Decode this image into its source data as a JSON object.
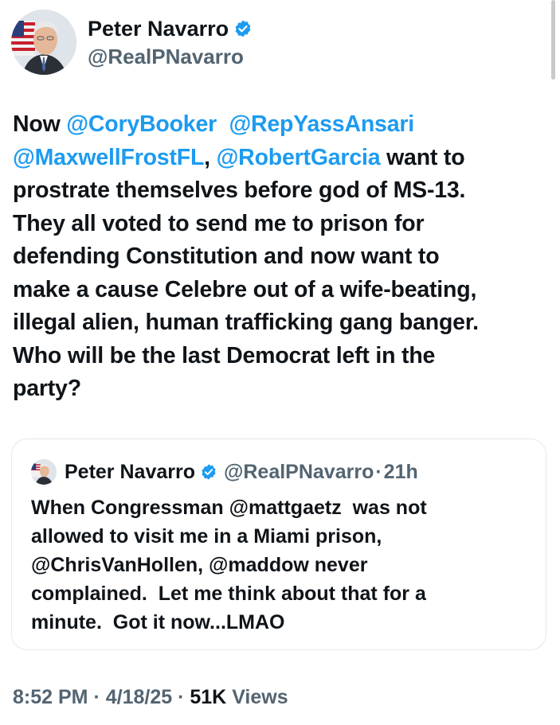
{
  "author": {
    "name": "Peter Navarro",
    "handle": "@RealPNavarro",
    "verified_icon": "verified-badge-icon",
    "avatar_icon": "profile-photo-icon"
  },
  "tweet": {
    "segments": [
      {
        "text": "Now ",
        "type": "text"
      },
      {
        "text": "@CoryBooker",
        "type": "mention"
      },
      {
        "text": "  ",
        "type": "text"
      },
      {
        "text": "@RepYassAnsari",
        "type": "mention"
      },
      {
        "text": "\n",
        "type": "text"
      },
      {
        "text": "@MaxwellFrostFL",
        "type": "mention"
      },
      {
        "text": ", ",
        "type": "text"
      },
      {
        "text": "@RobertGarcia",
        "type": "mention"
      },
      {
        "text": " want to\nprostrate themselves before god of MS-13.\nThey all voted to send me to prison for\ndefending Constitution and now want to\nmake a cause Celebre out of a wife-beating,\nillegal alien, human trafficking gang banger.\nWho will be the last Democrat left in the\nparty?",
        "type": "text"
      }
    ]
  },
  "quoted_tweet": {
    "name": "Peter Navarro",
    "handle": "@RealPNavarro",
    "separator": "·",
    "time": "21h",
    "text": "When Congressman @mattgaetz  was not\nallowed to visit me in a Miami prison,\n@ChrisVanHollen, @maddow never\ncomplained.  Let me think about that for a\nminute.  Got it now...LMAO"
  },
  "footer": {
    "time": "8:52 PM",
    "date": "4/18/25",
    "separator": "·",
    "views_count": "51K",
    "views_label": "Views"
  },
  "colors": {
    "text": "#0f1419",
    "secondary": "#536471",
    "accent": "#1d9bf0",
    "border": "#e1e8ed"
  }
}
